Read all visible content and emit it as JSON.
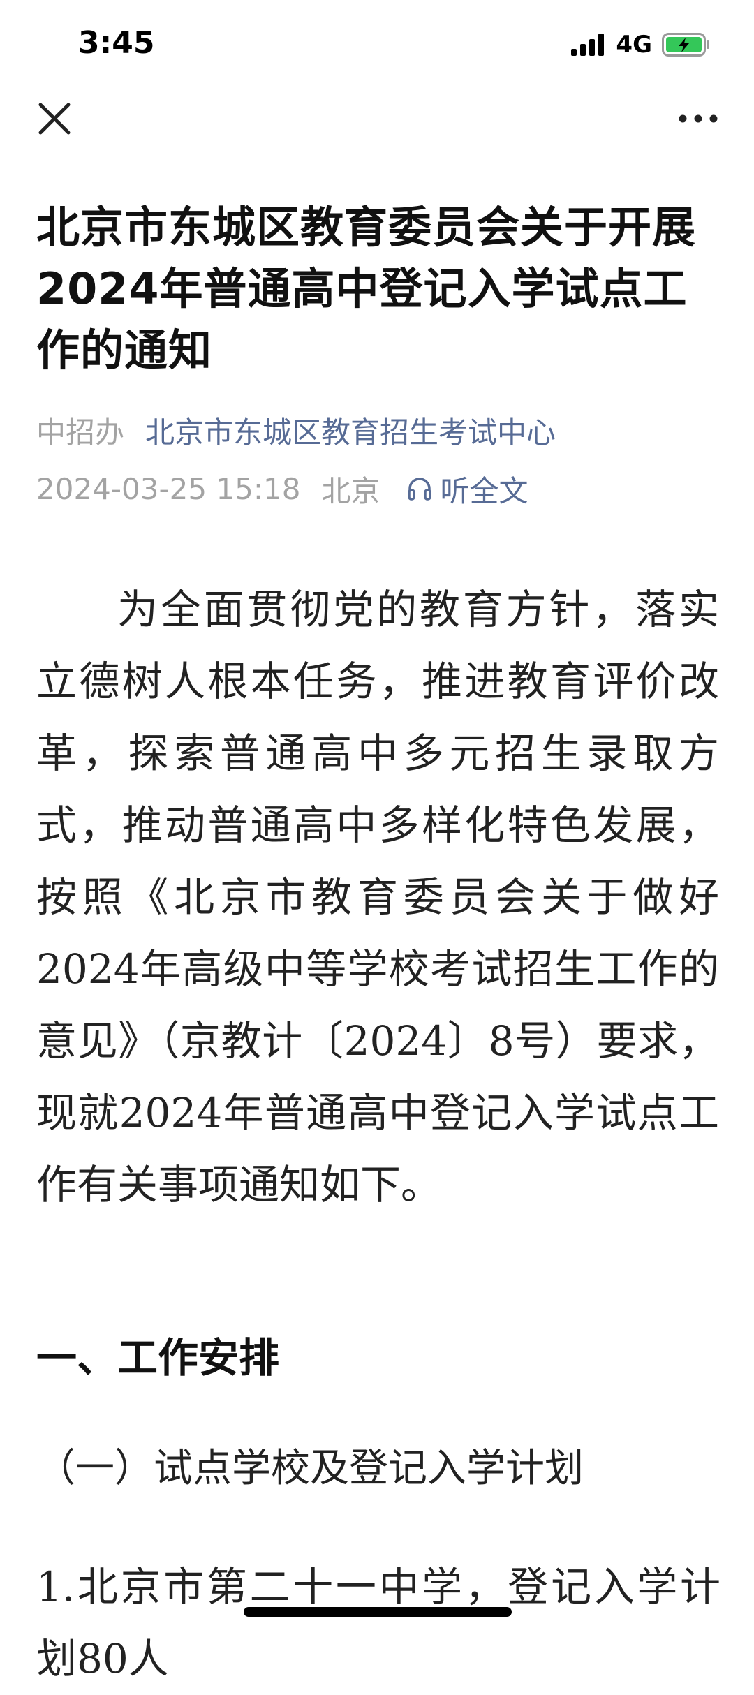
{
  "status_bar": {
    "time": "3:45",
    "network": "4G",
    "icons": [
      "signal-bars-icon",
      "battery-charging-icon"
    ],
    "battery_color": "#34c759"
  },
  "nav": {
    "icons": [
      "close-icon",
      "more-icon"
    ]
  },
  "article": {
    "title": "北京市东城区教育委员会关于开展2024年普通高中登记入学试点工作的通知",
    "source": "中招办",
    "account": "北京市东城区教育招生考试中心",
    "datetime": "2024-03-25 15:18",
    "location": "北京",
    "listen_label": "听全文",
    "body": "为全面贯彻党的教育方针，落实立德树人根本任务，推进教育评价改革，探索普通高中多元招生录取方式，推动普通高中多样化特色发展，按照《北京市教育委员会关于做好2024年高级中等学校考试招生工作的意见》（京教计〔2024〕8号）要求，现就2024年普通高中登记入学试点工作有关事项通知如下。",
    "section_heading": "一、工作安排",
    "sub_heading": "（一）试点学校及登记入学计划",
    "item_1": "1.北京市第二十一中学，登记入学计划80人"
  },
  "colors": {
    "link": "#576b95",
    "muted": "#a3a3a3",
    "text": "#222222"
  }
}
